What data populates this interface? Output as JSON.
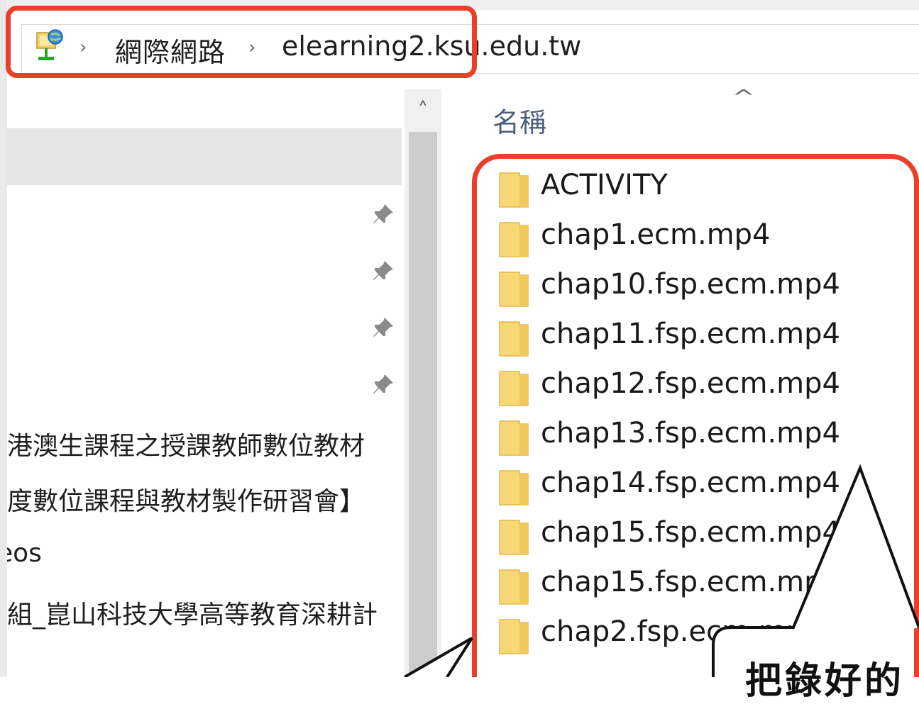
{
  "address_bar": {
    "icon": "network-globe-icon",
    "breadcrumb": [
      "網際網路",
      "elearning2.ksu.edu.tw"
    ],
    "separator": "›"
  },
  "nav_pane": {
    "items": [
      {
        "label": "",
        "pinned": false,
        "selected": true
      },
      {
        "label": "",
        "pinned": true
      },
      {
        "label": "",
        "pinned": true
      },
      {
        "label": "",
        "pinned": true
      },
      {
        "label": "",
        "pinned": true
      },
      {
        "label": "港澳生課程之授課教師數位教材"
      },
      {
        "label": "度數位課程與教材製作研習會】"
      },
      {
        "label": "eos"
      },
      {
        "label": "組_崑山科技大學高等教育深耕計"
      }
    ]
  },
  "file_list": {
    "column_name": "名稱",
    "sort_indicator": "^",
    "files": [
      {
        "name": "ACTIVITY",
        "icon": "folder-icon"
      },
      {
        "name": "chap1.ecm.mp4",
        "icon": "folder-icon"
      },
      {
        "name": "chap10.fsp.ecm.mp4",
        "icon": "folder-icon"
      },
      {
        "name": "chap11.fsp.ecm.mp4",
        "icon": "folder-icon"
      },
      {
        "name": "chap12.fsp.ecm.mp4",
        "icon": "folder-icon"
      },
      {
        "name": "chap13.fsp.ecm.mp4",
        "icon": "folder-icon"
      },
      {
        "name": "chap14.fsp.ecm.mp4",
        "icon": "folder-icon"
      },
      {
        "name": "chap15.fsp.ecm.mp4",
        "icon": "folder-icon"
      },
      {
        "name": "chap15.fsp.ecm.mp4",
        "icon": "folder-icon"
      },
      {
        "name": "chap2.fsp.ecm.mp4",
        "icon": "folder-icon"
      }
    ]
  },
  "annotation": {
    "callout_text": "把錄好的",
    "highlight_color": "#e8402a"
  }
}
